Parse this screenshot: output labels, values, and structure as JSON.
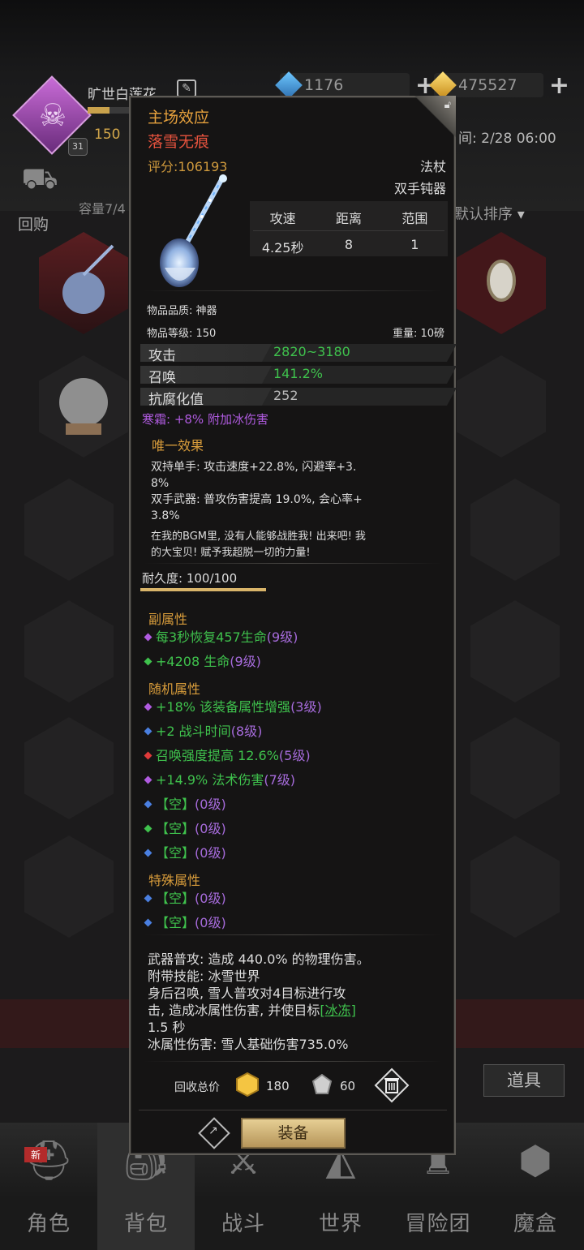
{
  "player": {
    "name": "旷世白莲花",
    "level": "31",
    "gold_partial": "150",
    "crystal": "1176",
    "gold_currency": "475527",
    "time_partial": "间: 2/28 06:00"
  },
  "bag": {
    "buyback_label": "回购",
    "capacity_partial": "容量7/4",
    "sort_label": "默认排序",
    "tools_label": "道具"
  },
  "nav": {
    "items": [
      {
        "label": "角色",
        "icon": "hero-helmet-icon",
        "new": "新"
      },
      {
        "label": "背包",
        "icon": "backpack-icon"
      },
      {
        "label": "战斗",
        "icon": "crossed-swords-icon"
      },
      {
        "label": "世界",
        "icon": "world-icon"
      },
      {
        "label": "冒险团",
        "icon": "guild-castle-icon"
      },
      {
        "label": "魔盒",
        "icon": "magic-box-icon"
      }
    ]
  },
  "item": {
    "effect_title": "主场效应",
    "name": "落雪无痕",
    "score": "评分:106193",
    "weapon_type": "法杖",
    "weapon_class": "双手钝器",
    "stats_headers": [
      "攻速",
      "距离",
      "范围"
    ],
    "stats_values": [
      "4.25秒",
      "8",
      "1"
    ],
    "quality": "物品品质: 神器",
    "level": "物品等级: 150",
    "weight": "重量: 10磅",
    "attrs": [
      {
        "name": "攻击",
        "value": "2820~3180"
      },
      {
        "name": "召唤",
        "value": "141.2%"
      },
      {
        "name": "抗腐化值",
        "value": "252"
      }
    ],
    "frost": "寒霜: +8% 附加冰伤害",
    "unique_title": "唯一效果",
    "unique_lines": [
      "双持单手: 攻击速度+22.8%, 闪避率+3.",
      "8%",
      "双手武器: 普攻伤害提高 19.0%, 会心率+",
      "3.8%"
    ],
    "flavor_lines": [
      "在我的BGM里, 没有人能够战胜我! 出来吧! 我",
      "的大宝贝! 赋予我超脱一切的力量!"
    ],
    "durability_label": "耐久度: 100/100",
    "durability_fraction": 1.0,
    "sub_title": "副属性",
    "sub_props": [
      {
        "text": "每3秒恢复457生命",
        "level": "(9级)",
        "color": "purple"
      },
      {
        "text": "+4208 生命",
        "level": "(9级)",
        "color": "green"
      }
    ],
    "random_title": "随机属性",
    "random_props": [
      {
        "text": "+18% 该装备属性增强",
        "level": "(3级)",
        "color": "purple"
      },
      {
        "text": "+2 战斗时间",
        "level": "(8级)",
        "color": "blue"
      },
      {
        "text": "召唤强度提高 12.6%",
        "level": "(5级)",
        "color": "red"
      },
      {
        "text": "+14.9% 法术伤害",
        "level": "(7级)",
        "color": "purple"
      },
      {
        "text": "【空】",
        "level": "(0级)",
        "color": "blue"
      },
      {
        "text": "【空】",
        "level": "(0级)",
        "color": "green"
      },
      {
        "text": "【空】",
        "level": "(0级)",
        "color": "blue"
      }
    ],
    "special_title": "特殊属性",
    "special_props": [
      {
        "text": "【空】",
        "level": "(0级)",
        "color": "blue"
      },
      {
        "text": "【空】",
        "level": "(0级)",
        "color": "blue"
      }
    ],
    "skill_lines": [
      "武器普攻: 造成 440.0% 的物理伤害。",
      "附带技能: 冰雪世界",
      "身后召唤, 雪人普攻对4目标进行攻",
      "击, 造成冰属性伤害, 并使目标",
      "1.5 秒",
      "冰属性伤害: 雪人基础伤害735.0%"
    ],
    "freeze_link": "[冰冻]",
    "recycle_label": "回收总价",
    "recycle_gold": "180",
    "recycle_shard": "60",
    "equip_label": "装备"
  },
  "colors": {
    "accent_gold": "#e8a23d",
    "item_name_red": "#e8533e",
    "purple": "#b05be0",
    "green": "#3fc24d"
  }
}
